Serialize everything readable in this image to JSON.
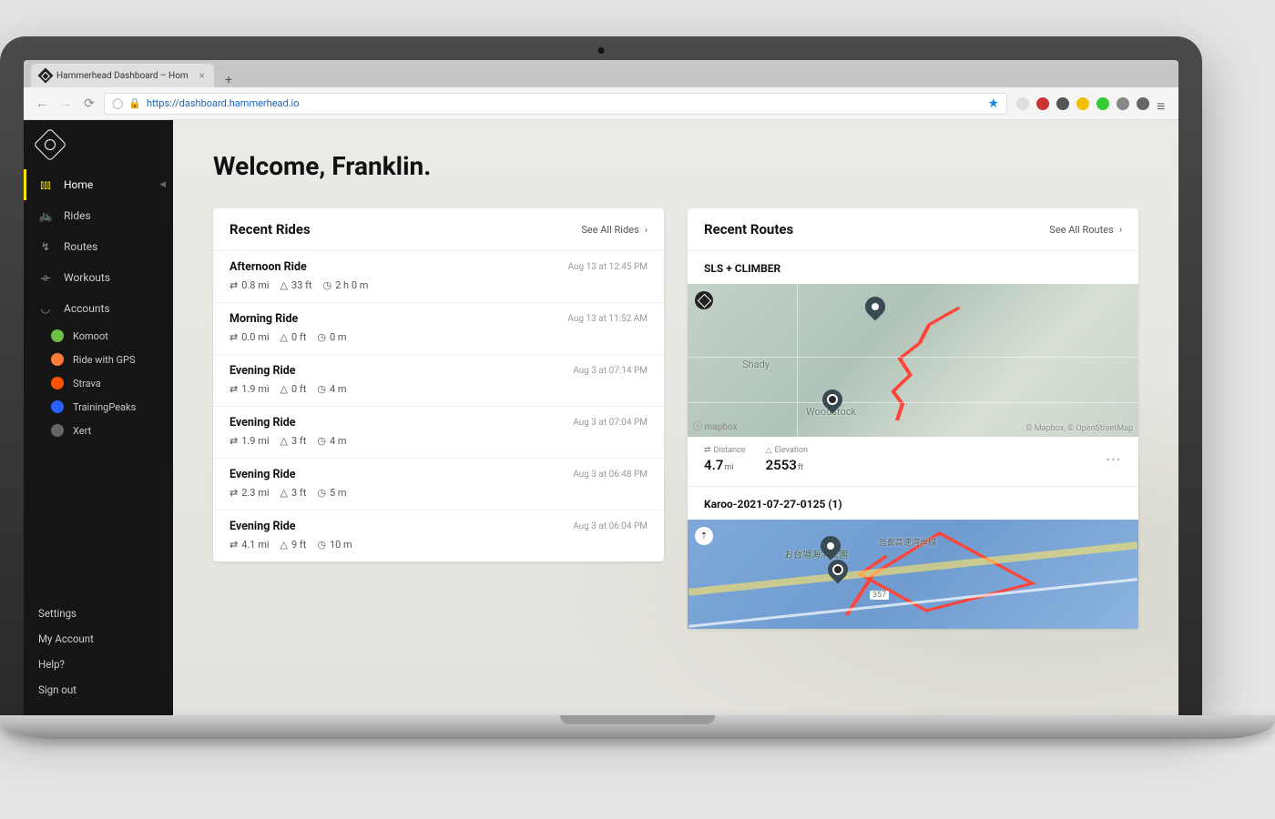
{
  "browser": {
    "tab_title": "Hammerhead Dashboard – Hom",
    "url_display": "https://dashboard.hammerhead.io"
  },
  "sidebar": {
    "nav": [
      {
        "label": "Home",
        "icon": "bars"
      },
      {
        "label": "Rides",
        "icon": "bike"
      },
      {
        "label": "Routes",
        "icon": "route"
      },
      {
        "label": "Workouts",
        "icon": "dumbbell"
      },
      {
        "label": "Accounts",
        "icon": "sync"
      }
    ],
    "accounts": [
      {
        "label": "Komoot",
        "cls": "green"
      },
      {
        "label": "Ride with GPS",
        "cls": "orange"
      },
      {
        "label": "Strava",
        "cls": "red"
      },
      {
        "label": "TrainingPeaks",
        "cls": "blue"
      },
      {
        "label": "Xert",
        "cls": "purple"
      }
    ],
    "bottom": [
      {
        "label": "Settings"
      },
      {
        "label": "My Account"
      },
      {
        "label": "Help?"
      },
      {
        "label": "Sign out"
      }
    ]
  },
  "page": {
    "title": "Welcome, Franklin.",
    "recent_rides_title": "Recent Rides",
    "see_all_rides": "See All Rides",
    "recent_routes_title": "Recent Routes",
    "see_all_routes": "See All Routes"
  },
  "rides": [
    {
      "name": "Afternoon Ride",
      "dist": "0.8 mi",
      "elev": "33 ft",
      "dur": "2 h 0 m",
      "time": "Aug 13 at 12:45 PM"
    },
    {
      "name": "Morning Ride",
      "dist": "0.0 mi",
      "elev": "0 ft",
      "dur": "0 m",
      "time": "Aug 13 at 11:52 AM"
    },
    {
      "name": "Evening Ride",
      "dist": "1.9 mi",
      "elev": "0 ft",
      "dur": "4 m",
      "time": "Aug 3 at 07:14 PM"
    },
    {
      "name": "Evening Ride",
      "dist": "1.9 mi",
      "elev": "3 ft",
      "dur": "4 m",
      "time": "Aug 3 at 07:04 PM"
    },
    {
      "name": "Evening Ride",
      "dist": "2.3 mi",
      "elev": "3 ft",
      "dur": "5 m",
      "time": "Aug 3 at 06:48 PM"
    },
    {
      "name": "Evening Ride",
      "dist": "4.1 mi",
      "elev": "9 ft",
      "dur": "10 m",
      "time": "Aug 3 at 06:04 PM"
    }
  ],
  "routes": [
    {
      "name": "SLS + CLIMBER",
      "distance_label": "Distance",
      "distance": "4.7",
      "distance_unit": "mi",
      "elevation_label": "Elevation",
      "elevation": "2553",
      "elevation_unit": "ft",
      "map_labels": [
        "Shady",
        "Woodstock"
      ],
      "map_attr": "© Mapbox, © OpenStreetMap",
      "map_logo": "ⓘ mapbox"
    },
    {
      "name": "Karoo-2021-07-27-0125 (1)",
      "map_labels": [
        "お台場海浜公園",
        "首都高速湾岸線",
        "357"
      ]
    }
  ]
}
